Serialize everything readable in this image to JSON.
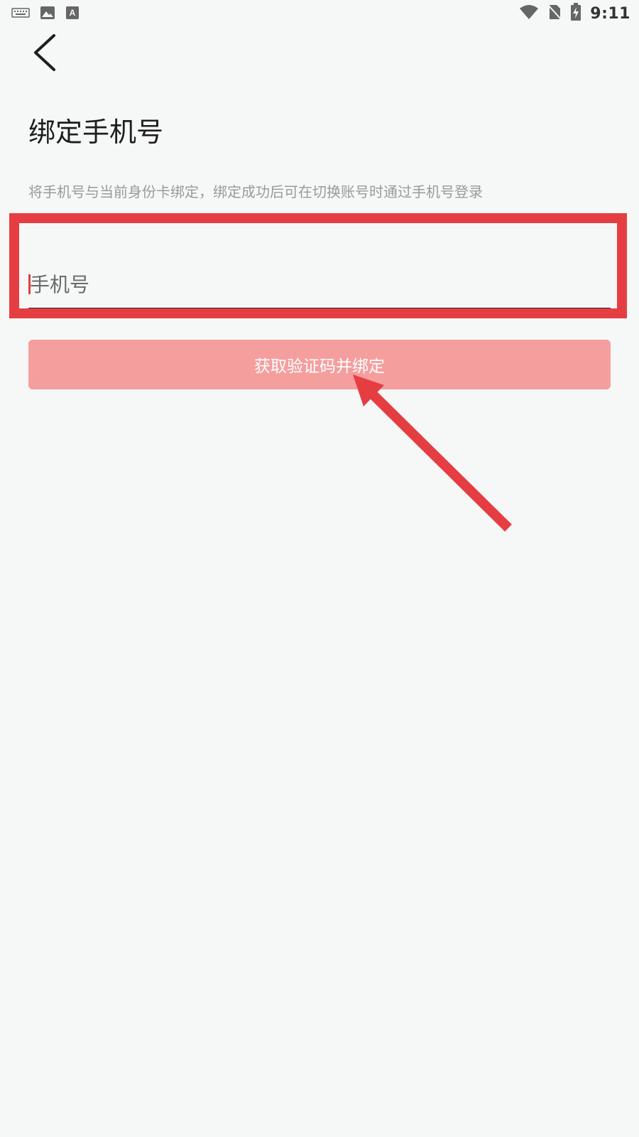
{
  "status_bar": {
    "time": "9:11",
    "left_icons": [
      "keyboard-icon",
      "image-icon",
      "text-a-icon"
    ],
    "right_icons": [
      "wifi-icon",
      "no-sim-icon",
      "battery-charging-icon"
    ]
  },
  "header": {
    "back_icon": "chevron-left-icon"
  },
  "main": {
    "title": "绑定手机号",
    "description": "将手机号与当前身份卡绑定，绑定成功后可在切换账号时通过手机号登录",
    "phone_input": {
      "placeholder": "手机号",
      "value": ""
    },
    "submit_label": "获取验证码并绑定"
  },
  "annotations": {
    "highlight_color": "#e53e42",
    "arrow_color": "#e53e42"
  },
  "colors": {
    "background": "#f6f7f7",
    "button_bg": "#f49e9e",
    "button_text": "#ffffff",
    "caret": "#e53e3e"
  }
}
